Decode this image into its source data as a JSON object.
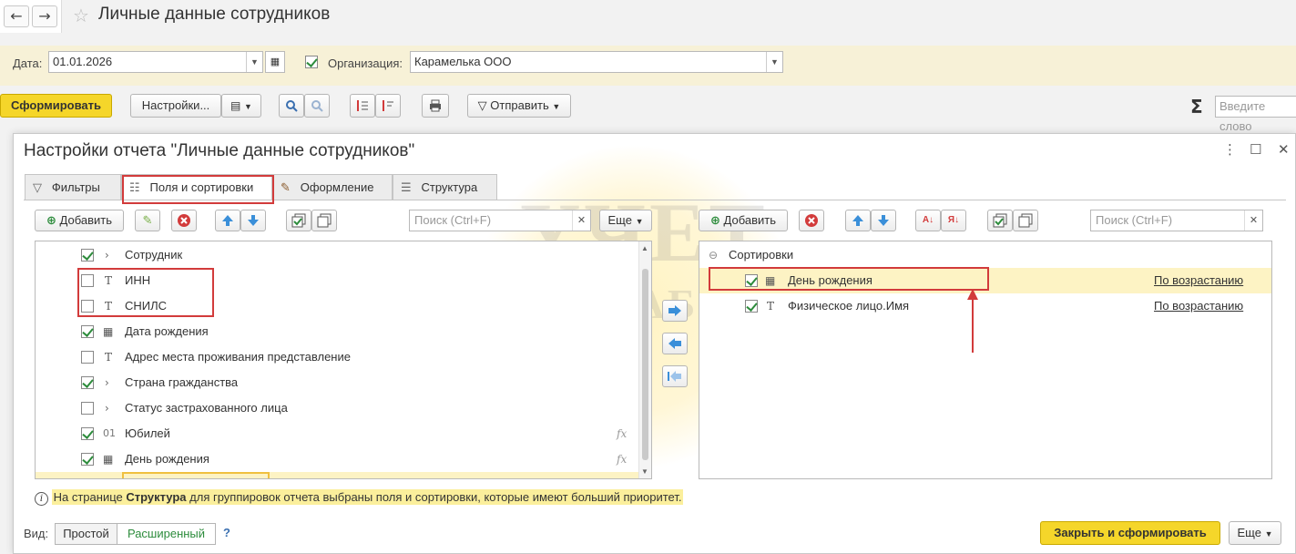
{
  "window": {
    "title": "Личные данные сотрудников"
  },
  "params": {
    "date_label": "Дата:",
    "date_value": "01.01.2026",
    "org_checked": true,
    "org_label": "Организация:",
    "org_value": "Карамелька ООО"
  },
  "toolbar": {
    "generate_label": "Сформировать",
    "settings_label": "Настройки...",
    "send_label": "Отправить",
    "search_placeholder": "Введите слово"
  },
  "dialog": {
    "title": "Настройки отчета \"Личные данные сотрудников\"",
    "tabs": [
      {
        "label": "Фильтры",
        "icon": "filter-icon",
        "active": false
      },
      {
        "label": "Поля и сортировки",
        "icon": "fields-sort-icon",
        "active": true
      },
      {
        "label": "Оформление",
        "icon": "brush-icon",
        "active": false
      },
      {
        "label": "Структура",
        "icon": "structure-icon",
        "active": false
      }
    ],
    "left": {
      "add_label": "Добавить",
      "search_placeholder": "Поиск (Ctrl+F)",
      "more_label": "Еще",
      "fields": [
        {
          "checked": true,
          "icon": ">",
          "label": "Сотрудник",
          "fx": false
        },
        {
          "checked": false,
          "icon": "T",
          "label": "ИНН",
          "fx": false
        },
        {
          "checked": false,
          "icon": "T",
          "label": "СНИЛС",
          "fx": false
        },
        {
          "checked": true,
          "icon": "calendar",
          "label": "Дата рождения",
          "fx": false
        },
        {
          "checked": false,
          "icon": "T",
          "label": "Адрес места проживания представление",
          "fx": false
        },
        {
          "checked": true,
          "icon": ">",
          "label": "Страна гражданства",
          "fx": false
        },
        {
          "checked": false,
          "icon": ">",
          "label": "Статус застрахованного лица",
          "fx": false
        },
        {
          "checked": true,
          "icon": "01",
          "label": "Юбилей",
          "fx": true
        },
        {
          "checked": true,
          "icon": "calendar",
          "label": "День рождения",
          "fx": true
        }
      ]
    },
    "right": {
      "add_label": "Добавить",
      "search_placeholder": "Поиск (Ctrl+F)",
      "group_label": "Сортировки",
      "sorts": [
        {
          "checked": true,
          "icon": "calendar",
          "label": "День рождения",
          "direction": "По возрастанию"
        },
        {
          "checked": true,
          "icon": "T",
          "label": "Физическое лицо.Имя",
          "direction": "По возрастанию"
        }
      ]
    },
    "info": {
      "prefix": "На странице ",
      "bold": "Структура",
      "suffix": " для группировок отчета выбраны поля и сортировки, которые имеют больший приоритет."
    },
    "footer": {
      "view_label": "Вид:",
      "simple_label": "Простой",
      "extended_label": "Расширенный",
      "help_label": "?",
      "close_generate_label": "Закрыть и сформировать",
      "more_label": "Еще"
    }
  },
  "watermark": {
    "line1": "УЧЕТ",
    "line2": "БЕЗ ЗАБОТ"
  },
  "colors": {
    "accent_yellow": "#f5d62a",
    "highlight": "#fdf3c4",
    "annotation_red": "#d23b3b",
    "check_green": "#2d8c3c"
  }
}
